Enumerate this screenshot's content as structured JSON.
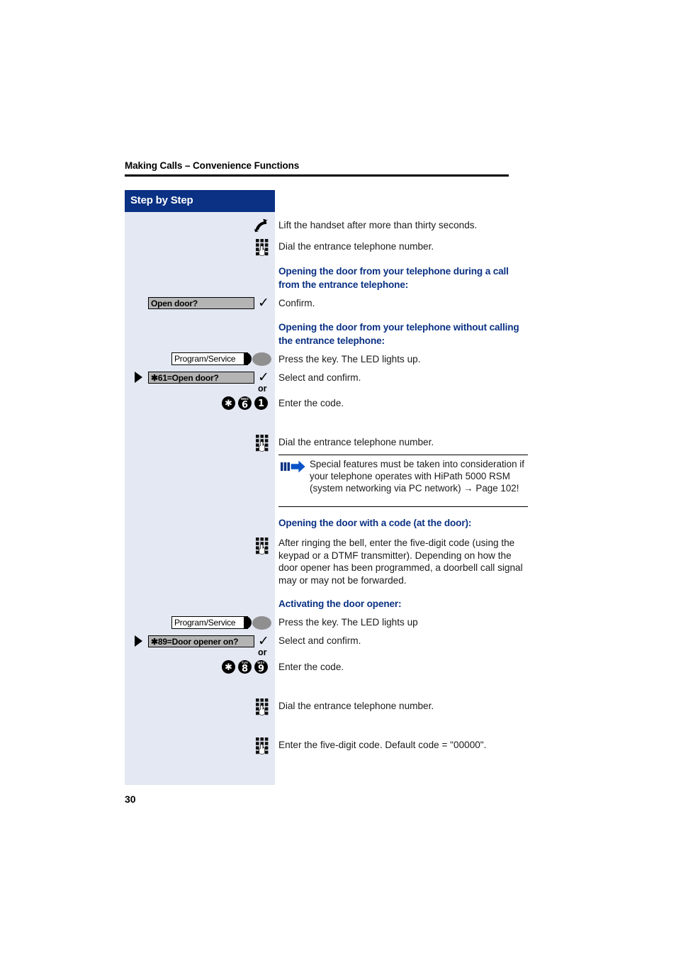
{
  "header": {
    "running_head": "Making Calls – Convenience Functions"
  },
  "sidebar": {
    "banner_label": "Step by Step"
  },
  "folio": {
    "page_number": "30"
  },
  "colors": {
    "accent_blue": "#0a3183",
    "panel_bg": "#e3e8f3",
    "display_gray": "#b4b4b4",
    "led_gray": "#8f8f8f"
  },
  "steps": [
    {
      "id": "lift-handset",
      "icon": "handset-icon",
      "text": "Lift the handset after more than thirty seconds."
    },
    {
      "id": "dial-entrance-1",
      "icon": "keypad-icon",
      "text": "Dial the entrance telephone number."
    }
  ],
  "headings": {
    "during_call": "Opening the door from your telephone during a call from the entrance telephone:",
    "without_calling": "Opening the door from your telephone without calling the entrance telephone:",
    "with_code": "Opening the door with a code (at the door):",
    "activating": "Activating the door opener:"
  },
  "confirm_step": {
    "display_label": "Open door?",
    "check_icon": "check-icon",
    "text": "Confirm."
  },
  "without_calling_steps": {
    "key_label": "Program/Service",
    "key_text": "Press the key. The LED lights up.",
    "menu_label": "✱61=Open door?",
    "menu_text": "Select and confirm.",
    "or_label": "or",
    "code_keys": [
      {
        "main": "✱",
        "sub": ""
      },
      {
        "main": "6",
        "sub": "MNO"
      },
      {
        "main": "1",
        "sub": ""
      }
    ],
    "code_text": "Enter the code.",
    "dial_text": "Dial the entrance telephone number."
  },
  "note": {
    "icon": "arrow-note-icon",
    "text": "Special features must be taken into consideration if your telephone operates with HiPath 5000 RSM (system networking via PC network) → Page 102!"
  },
  "with_code_step": {
    "icon": "keypad-icon",
    "text": "After ringing the bell, enter the five-digit code (using the keypad or a DTMF transmitter). Depending on how the door opener has been programmed, a doorbell call signal may or may not be forwarded."
  },
  "activating_steps": {
    "key_label": "Program/Service",
    "key_text": "Press the key. The LED lights up",
    "menu_label": "✱89=Door opener on?",
    "menu_text": "Select and confirm.",
    "or_label": "or",
    "code_keys": [
      {
        "main": "✱",
        "sub": ""
      },
      {
        "main": "8",
        "sub": "TUV"
      },
      {
        "main": "9",
        "sub": "WXY"
      }
    ],
    "code_text": "Enter the code.",
    "dial_text": "Dial the entrance telephone number.",
    "default_code_text": "Enter the five-digit code. Default code = \"00000\"."
  }
}
